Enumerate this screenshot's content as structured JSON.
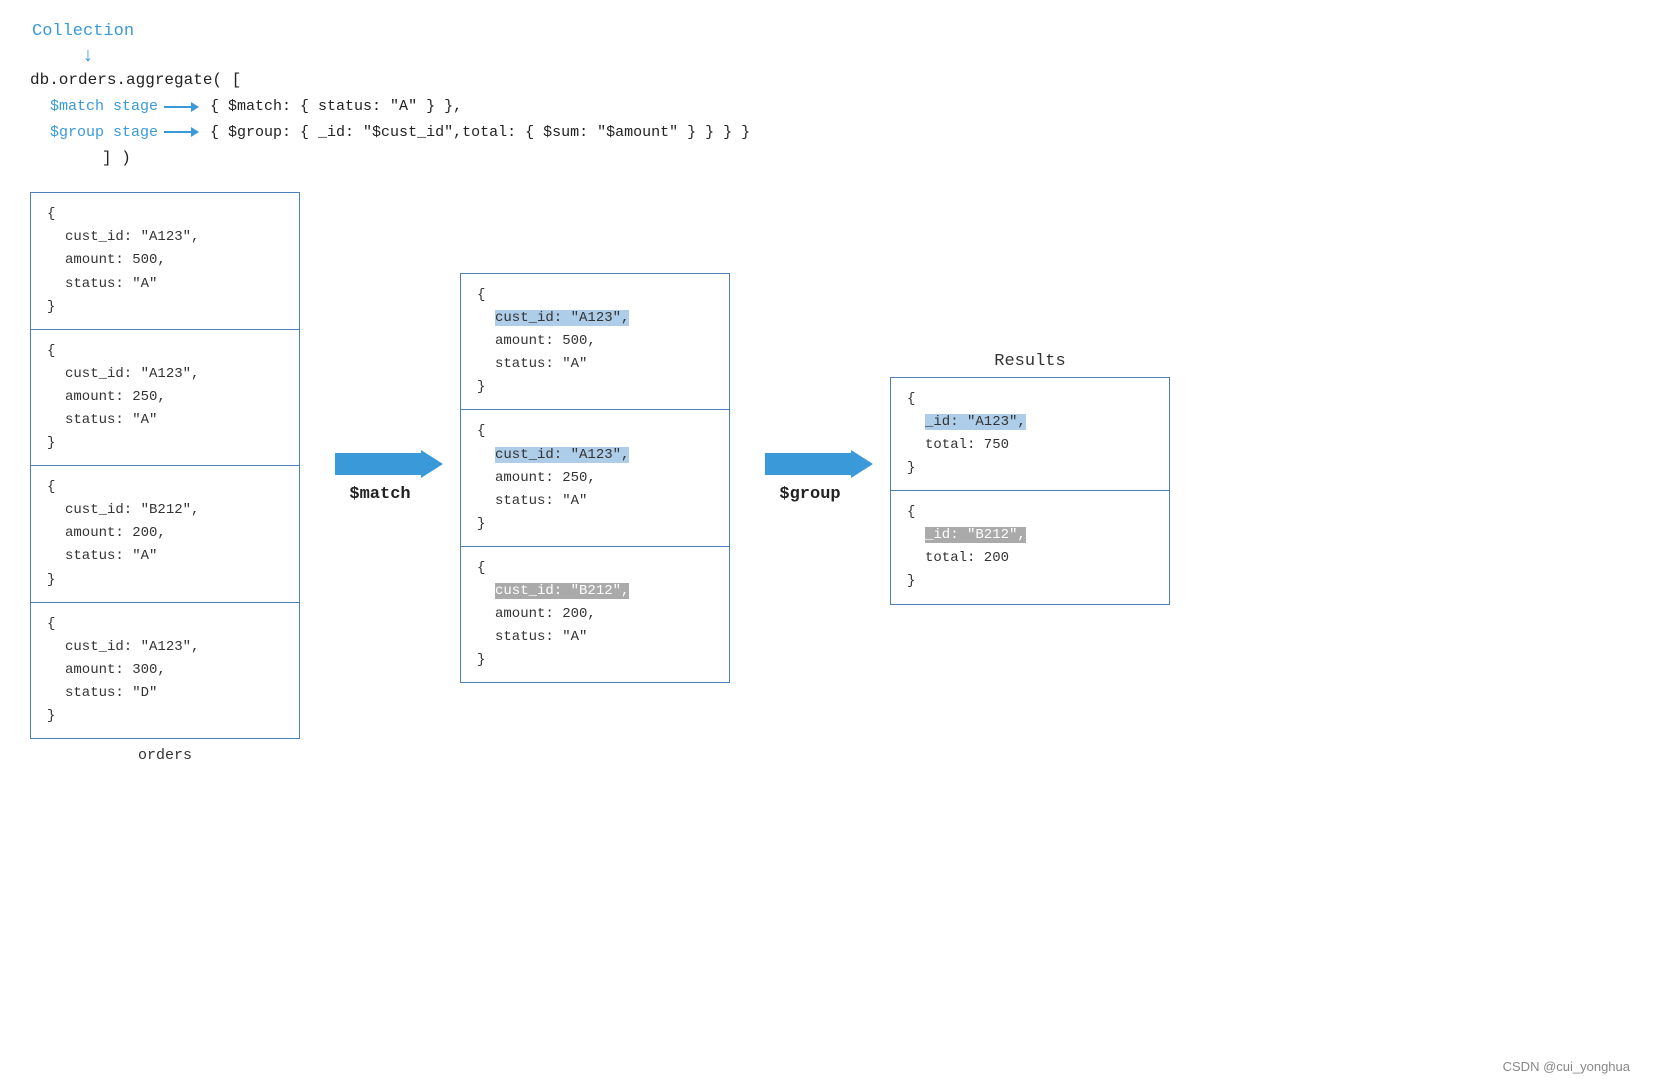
{
  "collection_label": "Collection",
  "code": {
    "line1": "db.orders.aggregate( [",
    "match_stage_label": "$match stage",
    "match_stage_code": "{ $match: { status: \"A\" } },",
    "group_stage_label": "$group stage",
    "group_stage_code": "{ $group: { _id: \"$cust_id\",total: { $sum: \"$amount\" } } } }",
    "line_end": "] )"
  },
  "orders_docs": [
    {
      "lines": [
        "{",
        "cust_id: \"A123\",",
        "amount: 500,",
        "status: \"A\"",
        "}"
      ],
      "highlight": "cust_id"
    },
    {
      "lines": [
        "{",
        "cust_id: \"A123\",",
        "amount: 250,",
        "status: \"A\"",
        "}"
      ],
      "highlight": "cust_id"
    },
    {
      "lines": [
        "{",
        "cust_id: \"B212\",",
        "amount: 200,",
        "status: \"A\"",
        "}"
      ],
      "highlight": "cust_id"
    },
    {
      "lines": [
        "{",
        "cust_id: \"A123\",",
        "amount: 300,",
        "status: \"D\"",
        "}"
      ],
      "highlight": null
    }
  ],
  "orders_label": "orders",
  "match_arrow_label": "$match",
  "matched_docs": [
    {
      "lines": [
        "{",
        "cust_id: \"A123\",",
        "amount: 500,",
        "status: \"A\"",
        "}"
      ],
      "highlight": "blue"
    },
    {
      "lines": [
        "{",
        "cust_id: \"A123\",",
        "amount: 250,",
        "status: \"A\"",
        "}"
      ],
      "highlight": "blue"
    },
    {
      "lines": [
        "{",
        "cust_id: \"B212\",",
        "amount: 200,",
        "status: \"A\"",
        "}"
      ],
      "highlight": "gray"
    }
  ],
  "group_arrow_label": "$group",
  "results_label": "Results",
  "result_docs": [
    {
      "lines": [
        "{",
        "_id: \"A123\",",
        "total: 750",
        "}"
      ],
      "highlight": "blue"
    },
    {
      "lines": [
        "{",
        "_id: \"B212\",",
        "total: 200",
        "}"
      ],
      "highlight": "gray"
    }
  ],
  "footer": "CSDN @cui_yonghua"
}
